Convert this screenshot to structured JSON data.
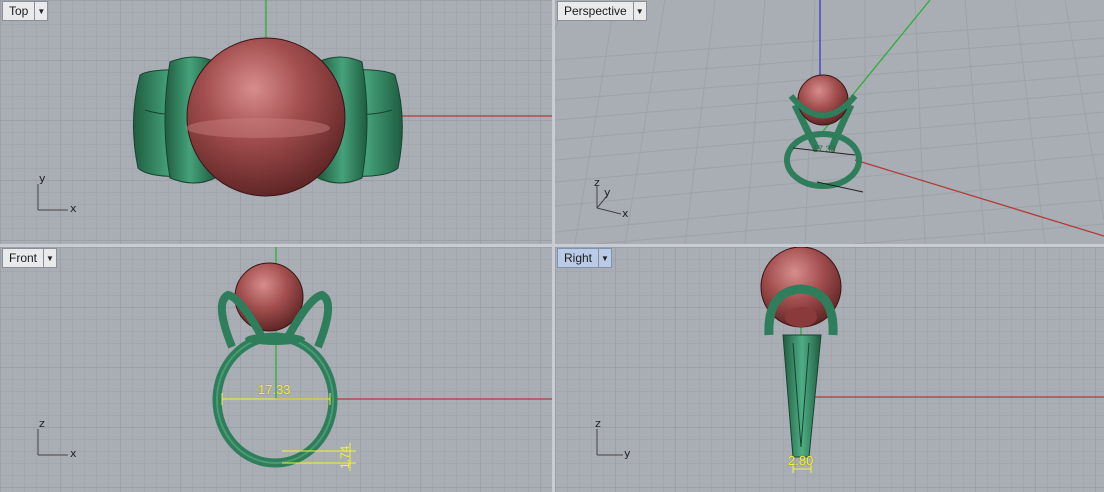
{
  "viewports": {
    "top": {
      "title": "Top",
      "axes": {
        "vertical": "y",
        "horizontal": "x"
      }
    },
    "perspective": {
      "title": "Perspective",
      "axes": {
        "vertical": "z",
        "depth": "y",
        "horizontal": "x"
      },
      "dimension": "17.33"
    },
    "front": {
      "title": "Front",
      "axes": {
        "vertical": "z",
        "horizontal": "x"
      },
      "dimensions": {
        "inner_diameter": "17.33",
        "band_thickness": "1.74"
      }
    },
    "right": {
      "title": "Right",
      "axes": {
        "vertical": "z",
        "horizontal": "y"
      },
      "dimensions": {
        "band_width": "2.80"
      },
      "active": true
    }
  },
  "colors": {
    "viewport_bg": "#a9adb4",
    "grid": "#9ea2a9",
    "x_axis": "#b23a3a",
    "y_axis": "#2fae3a",
    "z_axis": "#3b3bc8",
    "stone": "#9a4848",
    "metal": "#2e7d5b",
    "dimension": "#f2f23a"
  }
}
